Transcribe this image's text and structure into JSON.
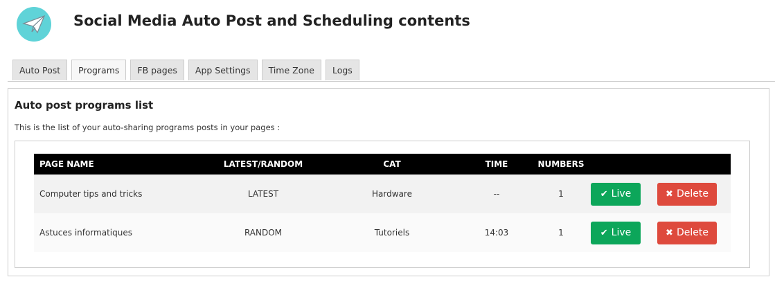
{
  "header": {
    "logo_icon": "paper-plane-icon",
    "title": "Social Media Auto Post and Scheduling contents",
    "accent_color": "#5fd3d8"
  },
  "tabs": [
    {
      "label": "Auto Post",
      "active": false
    },
    {
      "label": "Programs",
      "active": true
    },
    {
      "label": "FB pages",
      "active": false
    },
    {
      "label": "App Settings",
      "active": false
    },
    {
      "label": "Time Zone",
      "active": false
    },
    {
      "label": "Logs",
      "active": false
    }
  ],
  "panel": {
    "title": "Auto post programs list",
    "description": "This is the list of your auto-sharing programs posts in your pages :"
  },
  "table": {
    "headers": [
      "PAGE NAME",
      "LATEST/RANDOM",
      "CAT",
      "TIME",
      "NUMBERS",
      ""
    ],
    "rows": [
      {
        "page_name": "Computer tips and tricks",
        "mode": "LATEST",
        "cat": "Hardware",
        "time": "--",
        "numbers": "1",
        "live_label": "Live",
        "delete_label": "Delete"
      },
      {
        "page_name": "Astuces informatiques",
        "mode": "RANDOM",
        "cat": "Tutoriels",
        "time": "14:03",
        "numbers": "1",
        "live_label": "Live",
        "delete_label": "Delete"
      }
    ]
  },
  "colors": {
    "live_button": "#0ca65a",
    "delete_button": "#de4a3d",
    "table_header_bg": "#000000"
  },
  "icons": {
    "live": "check-icon",
    "delete": "x-icon"
  }
}
